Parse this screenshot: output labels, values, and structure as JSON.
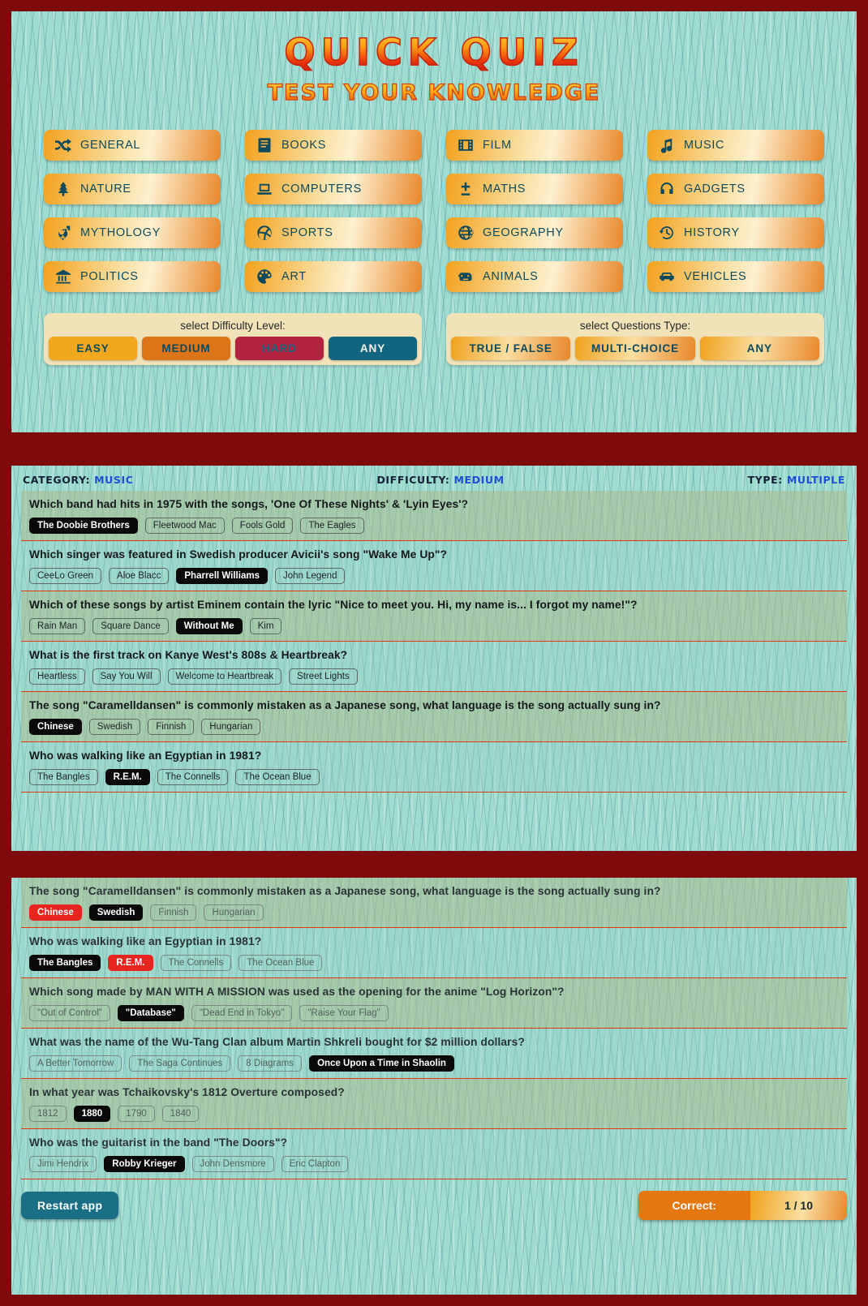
{
  "setup": {
    "title": "QUICK QUIZ",
    "subtitle": "TEST YOUR KNOWLEDGE",
    "categories": [
      {
        "label": "GENERAL",
        "icon": "shuffle-icon"
      },
      {
        "label": "BOOKS",
        "icon": "book-icon"
      },
      {
        "label": "FILM",
        "icon": "film-icon"
      },
      {
        "label": "MUSIC",
        "icon": "music-note-icon"
      },
      {
        "label": "NATURE",
        "icon": "tree-icon"
      },
      {
        "label": "COMPUTERS",
        "icon": "laptop-icon"
      },
      {
        "label": "MATHS",
        "icon": "plus-minus-icon"
      },
      {
        "label": "GADGETS",
        "icon": "headphones-icon"
      },
      {
        "label": "MYTHOLOGY",
        "icon": "mars-venus-icon"
      },
      {
        "label": "SPORTS",
        "icon": "basketball-icon"
      },
      {
        "label": "GEOGRAPHY",
        "icon": "globe-icon"
      },
      {
        "label": "HISTORY",
        "icon": "clock-history-icon"
      },
      {
        "label": "POLITICS",
        "icon": "bank-icon"
      },
      {
        "label": "ART",
        "icon": "palette-icon"
      },
      {
        "label": "ANIMALS",
        "icon": "hippo-icon"
      },
      {
        "label": "VEHICLES",
        "icon": "car-icon"
      }
    ],
    "difficulty": {
      "label": "select Difficulty Level:",
      "options": [
        "EASY",
        "MEDIUM",
        "HARD",
        "ANY"
      ]
    },
    "qtype": {
      "label": "select Questions Type:",
      "options": [
        "TRUE / FALSE",
        "MULTI-CHOICE",
        "ANY"
      ]
    },
    "colors": {
      "easy": "#f2a81c",
      "medium": "#dd7518",
      "hard": "#b32340",
      "any": "#11657f",
      "panel_bg": "#9fdcd0",
      "page_bg": "#7d0b0b"
    }
  },
  "quiz": {
    "header": {
      "category_label": "CATEGORY:",
      "category_value": "MUSIC",
      "difficulty_label": "DIFFICULTY:",
      "difficulty_value": "MEDIUM",
      "type_label": "TYPE:",
      "type_value": "MULTIPLE"
    },
    "questions": [
      {
        "text": "Which band had hits in 1975 with the songs, 'One Of These Nights' & 'Lyin Eyes'?",
        "answers": [
          {
            "label": "The Doobie Brothers",
            "state": "selected"
          },
          {
            "label": "Fleetwood Mac",
            "state": "normal"
          },
          {
            "label": "Fools Gold",
            "state": "normal"
          },
          {
            "label": "The Eagles",
            "state": "normal"
          }
        ]
      },
      {
        "text": "Which singer was featured in Swedish producer Avicii's song \"Wake Me Up\"?",
        "answers": [
          {
            "label": "CeeLo Green",
            "state": "normal"
          },
          {
            "label": "Aloe Blacc",
            "state": "normal"
          },
          {
            "label": "Pharrell Williams",
            "state": "selected"
          },
          {
            "label": "John Legend",
            "state": "normal"
          }
        ]
      },
      {
        "text": "Which of these songs by artist Eminem contain the lyric \"Nice to meet you. Hi, my name is... I forgot my name!\"?",
        "answers": [
          {
            "label": "Rain Man",
            "state": "normal"
          },
          {
            "label": "Square Dance",
            "state": "normal"
          },
          {
            "label": "Without Me",
            "state": "selected"
          },
          {
            "label": "Kim",
            "state": "normal"
          }
        ]
      },
      {
        "text": "What is the first track on Kanye West's 808s & Heartbreak?",
        "answers": [
          {
            "label": "Heartless",
            "state": "normal"
          },
          {
            "label": "Say You Will",
            "state": "normal"
          },
          {
            "label": "Welcome to Heartbreak",
            "state": "normal"
          },
          {
            "label": "Street Lights",
            "state": "normal"
          }
        ]
      },
      {
        "text": "The song \"Caramelldansen\" is commonly mistaken as a Japanese song, what language is the song actually sung in?",
        "answers": [
          {
            "label": "Chinese",
            "state": "selected"
          },
          {
            "label": "Swedish",
            "state": "normal"
          },
          {
            "label": "Finnish",
            "state": "normal"
          },
          {
            "label": "Hungarian",
            "state": "normal"
          }
        ]
      },
      {
        "text": "Who was walking like an Egyptian in 1981?",
        "answers": [
          {
            "label": "The Bangles",
            "state": "normal"
          },
          {
            "label": "R.E.M.",
            "state": "selected"
          },
          {
            "label": "The Connells",
            "state": "normal"
          },
          {
            "label": "The Ocean Blue",
            "state": "normal"
          }
        ]
      }
    ]
  },
  "result": {
    "questions": [
      {
        "text": "The song \"Caramelldansen\" is commonly mistaken as a Japanese song, what language is the song actually sung in?",
        "answers": [
          {
            "label": "Chinese",
            "state": "wrong"
          },
          {
            "label": "Swedish",
            "state": "correct"
          },
          {
            "label": "Finnish",
            "state": "dim"
          },
          {
            "label": "Hungarian",
            "state": "dim"
          }
        ]
      },
      {
        "text": "Who was walking like an Egyptian in 1981?",
        "answers": [
          {
            "label": "The Bangles",
            "state": "correct"
          },
          {
            "label": "R.E.M.",
            "state": "wrong"
          },
          {
            "label": "The Connells",
            "state": "dim"
          },
          {
            "label": "The Ocean Blue",
            "state": "dim"
          }
        ]
      },
      {
        "text": "Which song made by MAN WITH A MISSION was used as the opening for the anime \"Log Horizon\"?",
        "answers": [
          {
            "label": "\"Out of Control\"",
            "state": "dim"
          },
          {
            "label": "\"Database\"",
            "state": "correct"
          },
          {
            "label": "\"Dead End in Tokyo\"",
            "state": "dim"
          },
          {
            "label": "\"Raise Your Flag\"",
            "state": "dim"
          }
        ]
      },
      {
        "text": "What was the name of the Wu-Tang Clan album Martin Shkreli bought for $2 million dollars?",
        "answers": [
          {
            "label": "A Better Tomorrow",
            "state": "dim"
          },
          {
            "label": "The Saga Continues",
            "state": "dim"
          },
          {
            "label": "8 Diagrams",
            "state": "dim"
          },
          {
            "label": "Once Upon a Time in Shaolin",
            "state": "correct"
          }
        ]
      },
      {
        "text": "In what year was Tchaikovsky's 1812 Overture composed?",
        "answers": [
          {
            "label": "1812",
            "state": "dim"
          },
          {
            "label": "1880",
            "state": "correct"
          },
          {
            "label": "1790",
            "state": "dim"
          },
          {
            "label": "1840",
            "state": "dim"
          }
        ]
      },
      {
        "text": "Who was the guitarist in the band \"The Doors\"?",
        "answers": [
          {
            "label": "Jimi Hendrix",
            "state": "dim"
          },
          {
            "label": "Robby Krieger",
            "state": "correct"
          },
          {
            "label": "John Densmore",
            "state": "dim"
          },
          {
            "label": "Eric Clapton",
            "state": "dim"
          }
        ]
      }
    ],
    "restart_label": "Restart app",
    "score_label": "Correct:",
    "score_value": "1 / 10"
  }
}
